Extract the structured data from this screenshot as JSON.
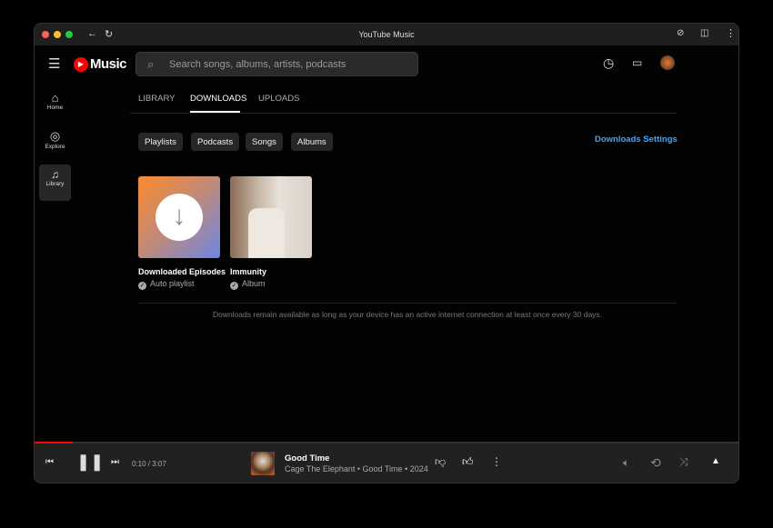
{
  "window": {
    "title": "YouTube Music"
  },
  "header": {
    "logo": "Music",
    "search_placeholder": "Search songs, albums, artists, podcasts"
  },
  "sidebar": {
    "items": [
      {
        "label": "Home"
      },
      {
        "label": "Explore"
      },
      {
        "label": "Library"
      }
    ]
  },
  "tabs": [
    {
      "label": "LIBRARY"
    },
    {
      "label": "DOWNLOADS"
    },
    {
      "label": "UPLOADS"
    }
  ],
  "chips": [
    "Playlists",
    "Podcasts",
    "Songs",
    "Albums"
  ],
  "settings_link": "Downloads Settings",
  "cards": [
    {
      "title": "Downloaded Episodes",
      "subtitle": "Auto playlist"
    },
    {
      "title": "Immunity",
      "subtitle": "Album"
    }
  ],
  "note": "Downloads remain available as long as your device has an active internet connection at least once every 30 days.",
  "player": {
    "time": "0:10 / 3:07",
    "title": "Good Time",
    "subtitle": "Cage The Elephant • Good Time • 2024",
    "progress": 0.054
  },
  "colors": {
    "accent": "#ff0000",
    "link": "#3ea6ff"
  }
}
